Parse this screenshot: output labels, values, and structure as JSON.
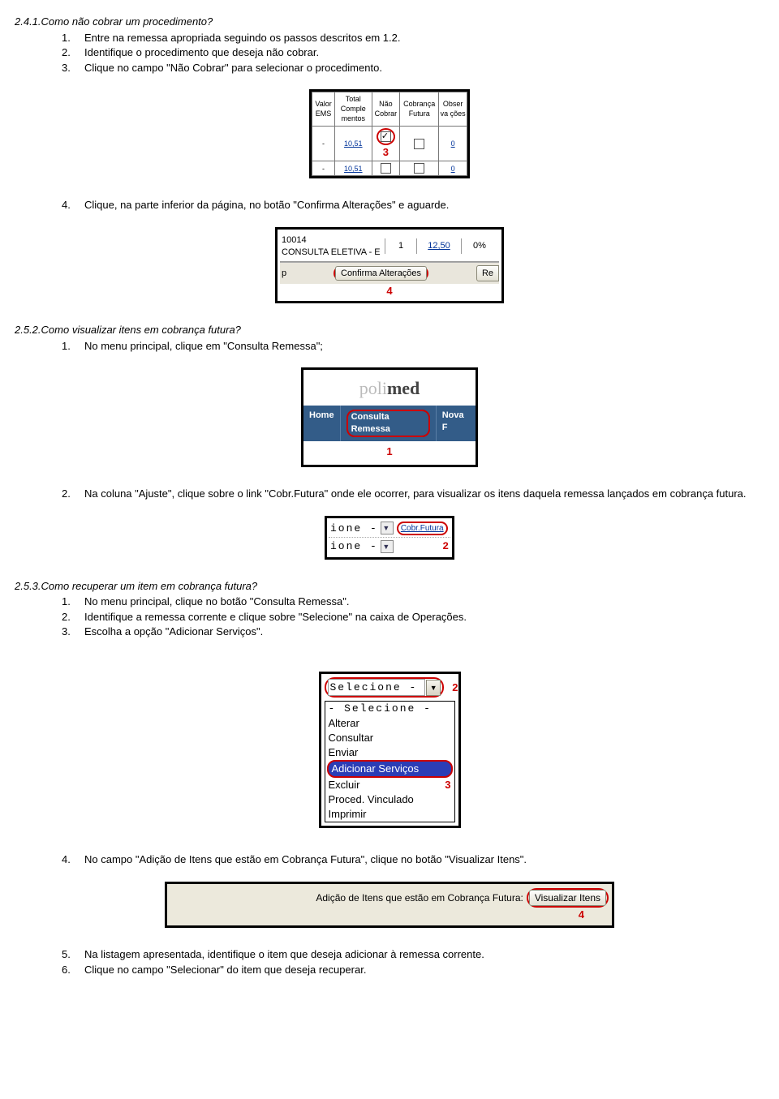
{
  "sec241": {
    "heading": "2.4.1.Como não cobrar um procedimento?",
    "items": [
      "Entre na remessa apropriada seguindo os passos descritos em 1.2.",
      "Identifique o procedimento que deseja não cobrar.",
      "Clique no campo \"Não Cobrar\" para selecionar o procedimento."
    ],
    "item4": "Clique, na parte inferior da página, no botão \"Confirma Alterações\" e aguarde."
  },
  "fig1": {
    "h1": "Valor EMS",
    "h2": "Total Comple mentos",
    "h3": "Não Cobrar",
    "h4": "Cobrança Futura",
    "h5": "Obser va ções",
    "r1": [
      "-",
      "10,51",
      "checked",
      "",
      "0"
    ],
    "r2": [
      "-",
      "10,51",
      "",
      "",
      "0"
    ],
    "marker": "3"
  },
  "fig2": {
    "code": "10014",
    "desc": "CONSULTA ELETIVA - E",
    "c2": "1",
    "c3": "12,50",
    "c4": "0%",
    "btn_left_stub": "p",
    "btn_confirm": "Confirma Alterações",
    "btn_right_stub": "Re",
    "marker": "4"
  },
  "sec252": {
    "heading": "2.5.2.Como visualizar itens em cobrança futura?",
    "item1": "No menu principal, clique em \"Consulta Remessa\";",
    "item2": "Na coluna \"Ajuste\", clique sobre o link \"Cobr.Futura\" onde ele ocorrer, para visualizar os itens daquela remessa lançados em cobrança futura."
  },
  "fig3": {
    "logo_a": "poli",
    "logo_b": "med",
    "tab1": "Home",
    "tab2": "Consulta Remessa",
    "tab3": "Nova F",
    "marker": "1"
  },
  "fig4": {
    "combo": "ione -",
    "link": "Cobr.Futura",
    "marker": "2"
  },
  "sec253": {
    "heading": "2.5.3.Como recuperar um item em cobrança futura?",
    "items": [
      "No menu principal, clique no botão \"Consulta Remessa\".",
      "Identifique a remessa corrente e clique sobre \"Selecione\" na caixa de Operações.",
      "Escolha a opção \"Adicionar Serviços\"."
    ],
    "item4": "No campo \"Adição de Itens que estão em Cobrança Futura\", clique no botão \"Visualizar Itens\".",
    "item5": "Na listagem apresentada, identifique o item que deseja adicionar à remessa corrente.",
    "item6": "Clique no campo \"Selecionar\" do item que deseja recuperar."
  },
  "fig5": {
    "selected": "Selecione -",
    "marker_top": "2",
    "opts": [
      "- Selecione -",
      "Alterar",
      "Consultar",
      "Enviar"
    ],
    "opt_hl": "Adicionar Serviços",
    "opts2": [
      "Excluir",
      "Proced. Vinculado",
      "Imprimir"
    ],
    "marker_mid": "3"
  },
  "fig6": {
    "label": "Adição de Itens que estão em Cobrança Futura:",
    "button": "Visualizar Itens",
    "marker": "4"
  }
}
